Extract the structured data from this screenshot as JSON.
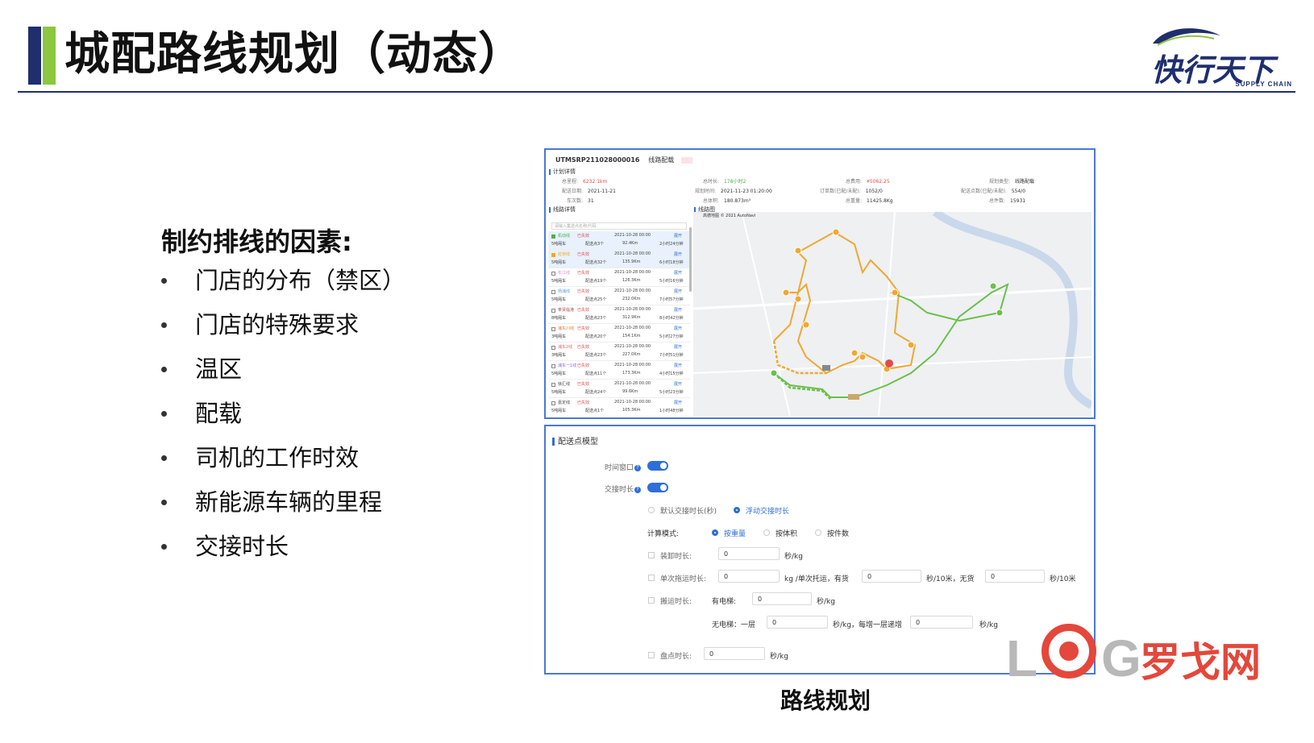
{
  "header": {
    "title": "城配路线规划（动态）",
    "logo_text": "快行天下",
    "logo_sub": "SUPPLY CHAIN"
  },
  "factors": {
    "title": "制约排线的因素:",
    "items": [
      "门店的分布（禁区）",
      "门店的特殊要求",
      "温区",
      "配载",
      "司机的工作时效",
      "新能源车辆的里程",
      "交接时长"
    ]
  },
  "plan": {
    "id": "UTMSRP211028000016",
    "type_label": "线路配载",
    "section_plan": "计划详情",
    "info": {
      "total_mileage_label": "总里程:",
      "total_mileage": "6232.1km",
      "total_duration_label": "总时长:",
      "total_duration": "178小时2",
      "total_cost_label": "总费用:",
      "total_cost": "¥5062.25",
      "plan_type_label": "规划类型:",
      "plan_type": "线路配载",
      "delivery_date_label": "配送日期:",
      "delivery_date": "2021-11-21",
      "plan_time_label": "规划时间:",
      "plan_time": "2021-11-23 01:20:00",
      "orders_label": "订单数(已配/未配):",
      "orders": "1052/0",
      "points_label": "配送点数(已配/未配):",
      "points": "554/0",
      "vehicles_label": "车次数:",
      "vehicles": "31",
      "volume_label": "总体积:",
      "volume": "180.873m³",
      "weight_label": "总重量:",
      "weight": "11425.8Kg",
      "pieces_label": "总件数:",
      "pieces": "15931"
    },
    "section_routes": "线路详情",
    "section_map": "线路图",
    "search_placeholder": "请输入集送点名称/代码",
    "map_credit": "高德地图 © 2021 AutoNavi",
    "routes": [
      {
        "name": "机动线",
        "status": "已失效",
        "date": "2021-10-28 00:00",
        "expand": "展开",
        "truck": "5吨厢车",
        "count": "配送点3个",
        "km": "92.4Km",
        "dur": "2小时24分钟"
      },
      {
        "name": "虹桥线",
        "status": "已失效",
        "date": "2021-10-28 00:00",
        "expand": "展开",
        "truck": "5吨厢车",
        "count": "配送点32个",
        "km": "135.9Km",
        "dur": "6小时18分钟"
      },
      {
        "name": "松江线",
        "status": "已失效",
        "date": "2021-10-28 00:00",
        "expand": "展开",
        "truck": "5吨厢车",
        "count": "配送点19个",
        "km": "126.3Km",
        "dur": "5小时16分钟"
      },
      {
        "name": "杨浦线",
        "status": "已失效",
        "date": "2021-10-28 00:00",
        "expand": "展开",
        "truck": "5吨厢车",
        "count": "配送点25个",
        "km": "232.0Km",
        "dur": "7小时57分钟"
      },
      {
        "name": "奉贤临港",
        "status": "已失效",
        "date": "2021-10-28 00:00",
        "expand": "展开",
        "truck": "8吨厢车",
        "count": "配送点23个",
        "km": "312.9Km",
        "dur": "8小时42分钟"
      },
      {
        "name": "浦东川线",
        "status": "已失效",
        "date": "2021-10-28 00:00",
        "expand": "展开",
        "truck": "3吨厢车",
        "count": "配送点20个",
        "km": "154.1Km",
        "dur": "5小时27分钟"
      },
      {
        "name": "浦东2线",
        "status": "已失效",
        "date": "2021-10-28 00:00",
        "expand": "展开",
        "truck": "3吨厢车",
        "count": "配送点23个",
        "km": "227.0Km",
        "dur": "7小时51分钟"
      },
      {
        "name": "浦东一1线",
        "status": "已失效",
        "date": "2021-10-28 00:00",
        "expand": "展开",
        "truck": "5吨厢车",
        "count": "配送点11个",
        "km": "173.3Km",
        "dur": "4小时15分钟"
      },
      {
        "name": "徐汇线",
        "status": "已失效",
        "date": "2021-10-28 00:00",
        "expand": "展开",
        "truck": "5吨厢车",
        "count": "配送点24个",
        "km": "99.6Km",
        "dur": "5小时23分钟"
      },
      {
        "name": "嘉定线",
        "status": "已失效",
        "date": "2021-10-28 00:00",
        "expand": "展开",
        "truck": "5吨厢车",
        "count": "配送点1个",
        "km": "105.3Km",
        "dur": "1小时48分钟"
      }
    ]
  },
  "model": {
    "title": "配送点模型",
    "time_window": "时间窗口",
    "handover_duration": "交接时长",
    "default_handover": "默认交接时长(秒)",
    "floating_handover": "浮动交接时长",
    "calc_mode_label": "计算模式:",
    "mode_weight": "按重量",
    "mode_volume": "按体积",
    "mode_pieces": "按件数",
    "unload_label": "装卸时长:",
    "unload_value": "0",
    "unit_s_kg": "秒/kg",
    "drag_label": "单次拖运时长:",
    "drag_value": "0",
    "drag_unit_1": "kg /单次托运，有货",
    "drag_value_2": "0",
    "drag_unit_2": "秒/10米，无货",
    "drag_value_3": "0",
    "drag_unit_3": "秒/10米",
    "carry_label": "搬运时长:",
    "elevator_label": "有电梯:",
    "elevator_value": "0",
    "elevator_unit": "秒/kg",
    "no_elevator_label": "无电梯：一层",
    "no_elevator_value": "0",
    "no_elevator_unit": "秒/kg，每增一层递增",
    "no_elevator_value_2": "0",
    "no_elevator_unit_2": "秒/kg",
    "count_label": "盘点时长:",
    "count_value": "0",
    "count_unit": "秒/kg"
  },
  "caption": "路线规划",
  "watermark": {
    "letter_l": "L",
    "letter_g": "G",
    "text": "罗戈网"
  },
  "colors": {
    "navy": "#1f2f6e",
    "green": "#8dc63f",
    "accent_blue": "#2f6fd6",
    "route_orange": "#f0a830",
    "route_green": "#6cbf4a",
    "watermark_red": "#e4473b"
  }
}
